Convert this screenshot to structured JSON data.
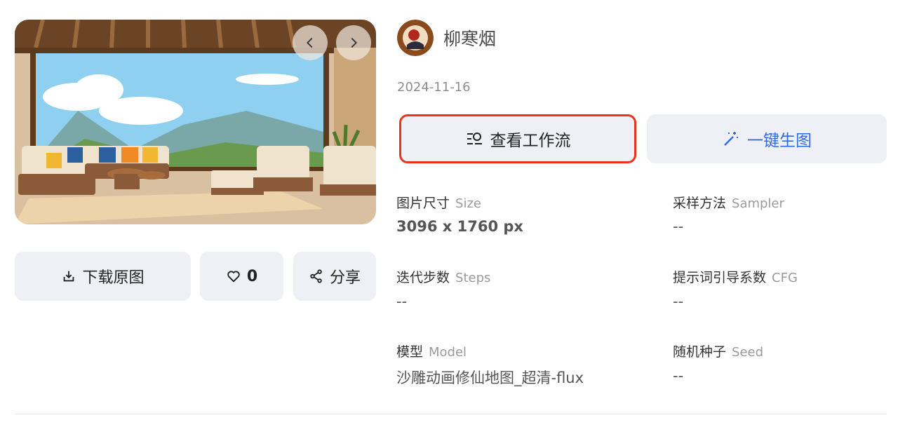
{
  "preview": {
    "prev_icon": "chevron-left-icon",
    "next_icon": "chevron-right-icon"
  },
  "actions": {
    "download_label": "下载原图",
    "download_icon": "download-icon",
    "like_count": "0",
    "like_icon": "heart-icon",
    "share_label": "分享",
    "share_icon": "share-icon"
  },
  "author": {
    "name": "柳寒烟",
    "date": "2024-11-16"
  },
  "buttons": {
    "workflow_label": "查看工作流",
    "workflow_icon": "workflow-icon",
    "generate_label": "一键生图",
    "generate_icon": "magic-wand-icon"
  },
  "params": [
    {
      "label": "图片尺寸",
      "label_en": "Size",
      "value": "3096 x 1760 px"
    },
    {
      "label": "采样方法",
      "label_en": "Sampler",
      "value": "--"
    },
    {
      "label": "迭代步数",
      "label_en": "Steps",
      "value": "--"
    },
    {
      "label": "提示词引导系数",
      "label_en": "CFG",
      "value": "--"
    },
    {
      "label": "模型",
      "label_en": "Model",
      "value": "沙雕动画修仙地图_超清-flux"
    },
    {
      "label": "随机种子",
      "label_en": "Seed",
      "value": "--"
    }
  ],
  "colors": {
    "highlight_border": "#e8341c",
    "accent_blue": "#2f6de4",
    "button_bg": "#eef0f5"
  }
}
